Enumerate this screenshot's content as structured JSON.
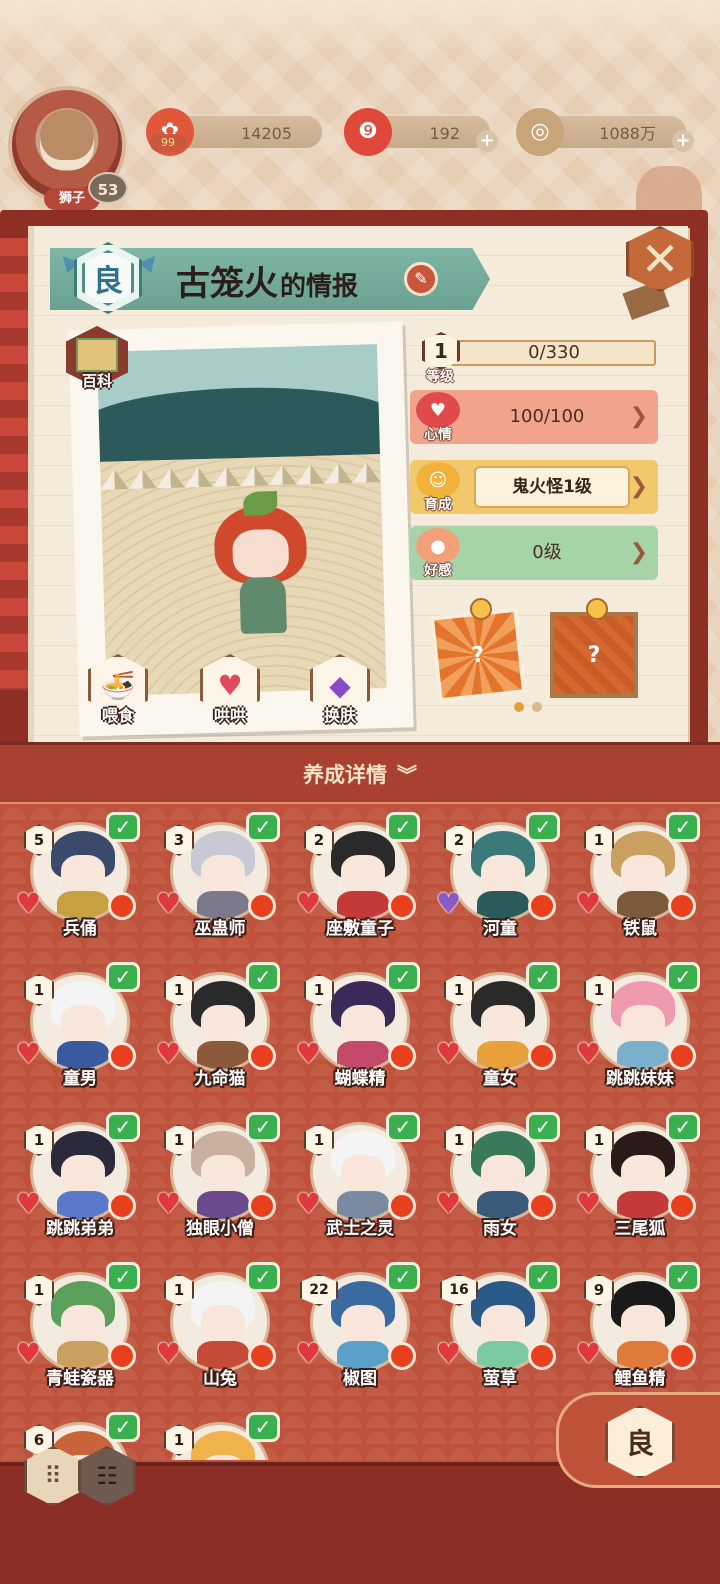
{
  "player": {
    "name": "狮子",
    "level": "53"
  },
  "currency": {
    "coins": "14205",
    "coins_badge": "99",
    "gems": "192",
    "money": "1088万"
  },
  "info_panel": {
    "rank": "良",
    "name": "古笼火",
    "title_suffix": "的情报",
    "baike_label": "百科"
  },
  "actions": {
    "feed_label": "喂食",
    "coax_label": "哄哄",
    "skin_label": "换肤"
  },
  "stats": {
    "level_label": "等级",
    "level_value": "1",
    "exp_text": "0/330",
    "exp_fraction": 0,
    "mood_label": "心情",
    "mood_text": "100/100",
    "growth_label": "育成",
    "growth_text": "鬼火怪1级",
    "favor_label": "好感",
    "favor_text": "0级"
  },
  "rewards": {
    "mystery_1": "?",
    "mystery_2": "?",
    "page_count": 2,
    "page_active": 1
  },
  "details_header": "养成详情",
  "characters": [
    {
      "name": "兵俑",
      "level": "5",
      "heart": "red",
      "hair": "#3a4a6a",
      "body": "#c9a040"
    },
    {
      "name": "巫蛊师",
      "level": "3",
      "heart": "red",
      "hair": "#c9c9d6",
      "body": "#7a7a8a"
    },
    {
      "name": "座敷童子",
      "level": "2",
      "heart": "red",
      "hair": "#2a2a2a",
      "body": "#c43a3a"
    },
    {
      "name": "河童",
      "level": "2",
      "heart": "purple",
      "hair": "#3a7a7a",
      "body": "#2a5a5a"
    },
    {
      "name": "铁鼠",
      "level": "1",
      "heart": "red",
      "hair": "#c9a060",
      "body": "#7a5a3a"
    },
    {
      "name": "童男",
      "level": "1",
      "heart": "red",
      "hair": "#f4f4f4",
      "body": "#3a5aa0"
    },
    {
      "name": "九命猫",
      "level": "1",
      "heart": "red",
      "hair": "#2a2a2a",
      "body": "#8a5a3a"
    },
    {
      "name": "蝴蝶精",
      "level": "1",
      "heart": "red",
      "hair": "#3a2a5a",
      "body": "#c44a6a"
    },
    {
      "name": "童女",
      "level": "1",
      "heart": "red",
      "hair": "#2a2a2a",
      "body": "#e8a03a"
    },
    {
      "name": "跳跳妹妹",
      "level": "1",
      "heart": "red",
      "hair": "#f09ab0",
      "body": "#7ab0c9"
    },
    {
      "name": "跳跳弟弟",
      "level": "1",
      "heart": "red",
      "hair": "#2a2a3a",
      "body": "#5a7ac9"
    },
    {
      "name": "独眼小僧",
      "level": "1",
      "heart": "red",
      "hair": "#c9b0a0",
      "body": "#6a4a8a"
    },
    {
      "name": "武士之灵",
      "level": "1",
      "heart": "red",
      "hair": "#f4f4f4",
      "body": "#7a8aa0"
    },
    {
      "name": "雨女",
      "level": "1",
      "heart": "red",
      "hair": "#3a7a5a",
      "body": "#3a5a7a"
    },
    {
      "name": "三尾狐",
      "level": "1",
      "heart": "red",
      "hair": "#2a1a1a",
      "body": "#c43a3a"
    },
    {
      "name": "青蛙瓷器",
      "level": "1",
      "heart": "red",
      "hair": "#5aa05a",
      "body": "#c9a060"
    },
    {
      "name": "山兔",
      "level": "1",
      "heart": "red",
      "hair": "#f4f4f4",
      "body": "#c44a3a"
    },
    {
      "name": "椒图",
      "level": "22",
      "heart": "red",
      "hair": "#3a6aa0",
      "body": "#5aa0c9"
    },
    {
      "name": "萤草",
      "level": "16",
      "heart": "red",
      "hair": "#2a5a8a",
      "body": "#7ac9a0"
    },
    {
      "name": "鲤鱼精",
      "level": "9",
      "heart": "red",
      "hair": "#1a1a1a",
      "body": "#e07a3a"
    },
    {
      "name": "",
      "level": "6",
      "heart": "red",
      "hair": "#c9643a",
      "body": "#c9643a"
    },
    {
      "name": "",
      "level": "1",
      "heart": "red",
      "hair": "#f0b24a",
      "body": "#f0b24a"
    }
  ],
  "bottom": {
    "rank_filter": "良"
  },
  "colors": {
    "accent_red": "#b3473a",
    "check_green": "#39b04d",
    "banner_teal": "#7fb5a4"
  }
}
